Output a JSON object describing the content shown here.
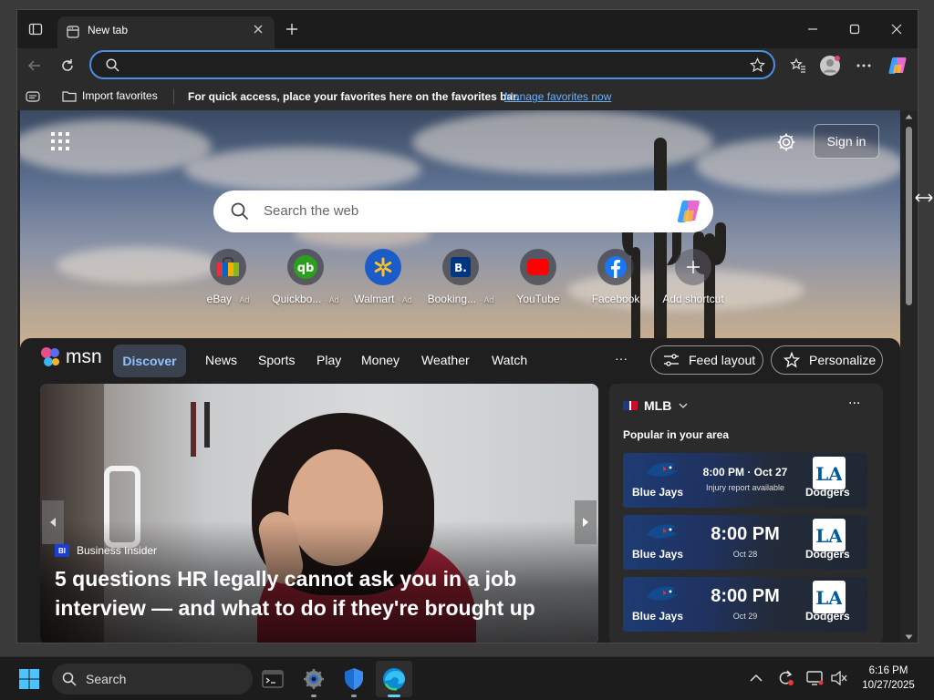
{
  "browser": {
    "tab": {
      "title": "New tab"
    },
    "address": {
      "placeholder": ""
    },
    "favorites_bar": {
      "import_label": "Import favorites",
      "message": "For quick access, place your favorites here on the favorites bar.",
      "manage_link": "Manage favorites now"
    }
  },
  "newtab": {
    "sign_in": "Sign in",
    "search": {
      "placeholder": "Search the web"
    },
    "quick_links": [
      {
        "label": "eBay",
        "ad": "· Ad",
        "icon": "ebay-bag-icon"
      },
      {
        "label": "Quickbo...",
        "ad": "· Ad",
        "icon": "quickbooks-icon"
      },
      {
        "label": "Walmart",
        "ad": "· Ad",
        "icon": "walmart-spark-icon"
      },
      {
        "label": "Booking...",
        "ad": "· Ad",
        "icon": "booking-icon"
      },
      {
        "label": "YouTube",
        "ad": "",
        "icon": "youtube-icon"
      },
      {
        "label": "Facebook",
        "ad": "",
        "icon": "facebook-icon"
      },
      {
        "label": "Add shortcut",
        "ad": "",
        "icon": "plus-icon"
      }
    ]
  },
  "msn": {
    "logo_text": "msn",
    "nav": [
      "Discover",
      "News",
      "Sports",
      "Play",
      "Money",
      "Weather",
      "Watch"
    ],
    "more": "···",
    "feed_layout": "Feed layout",
    "personalize": "Personalize",
    "hero": {
      "source_badge": "BI",
      "source": "Business Insider",
      "headline_line1": "5 questions HR legally cannot ask you in a job",
      "headline_line2": "interview — and what to do if they're brought up"
    },
    "side": {
      "league": "MLB",
      "subtitle": "Popular in your area",
      "more": "···",
      "games": [
        {
          "home": "Blue Jays",
          "away": "Dodgers",
          "time": "8:00 PM · Oct 27",
          "note": "Injury report available"
        },
        {
          "home": "Blue Jays",
          "away": "Dodgers",
          "time": "8:00 PM",
          "note": "Oct 28"
        },
        {
          "home": "Blue Jays",
          "away": "Dodgers",
          "time": "8:00 PM",
          "note": "Oct 29"
        }
      ]
    }
  },
  "taskbar": {
    "search_label": "Search",
    "clock_time": "6:16 PM",
    "clock_date": "10/27/2025"
  },
  "colors": {
    "accent": "#4a90e2",
    "link": "#6bb0ff",
    "discover_bg": "#3a4250"
  }
}
